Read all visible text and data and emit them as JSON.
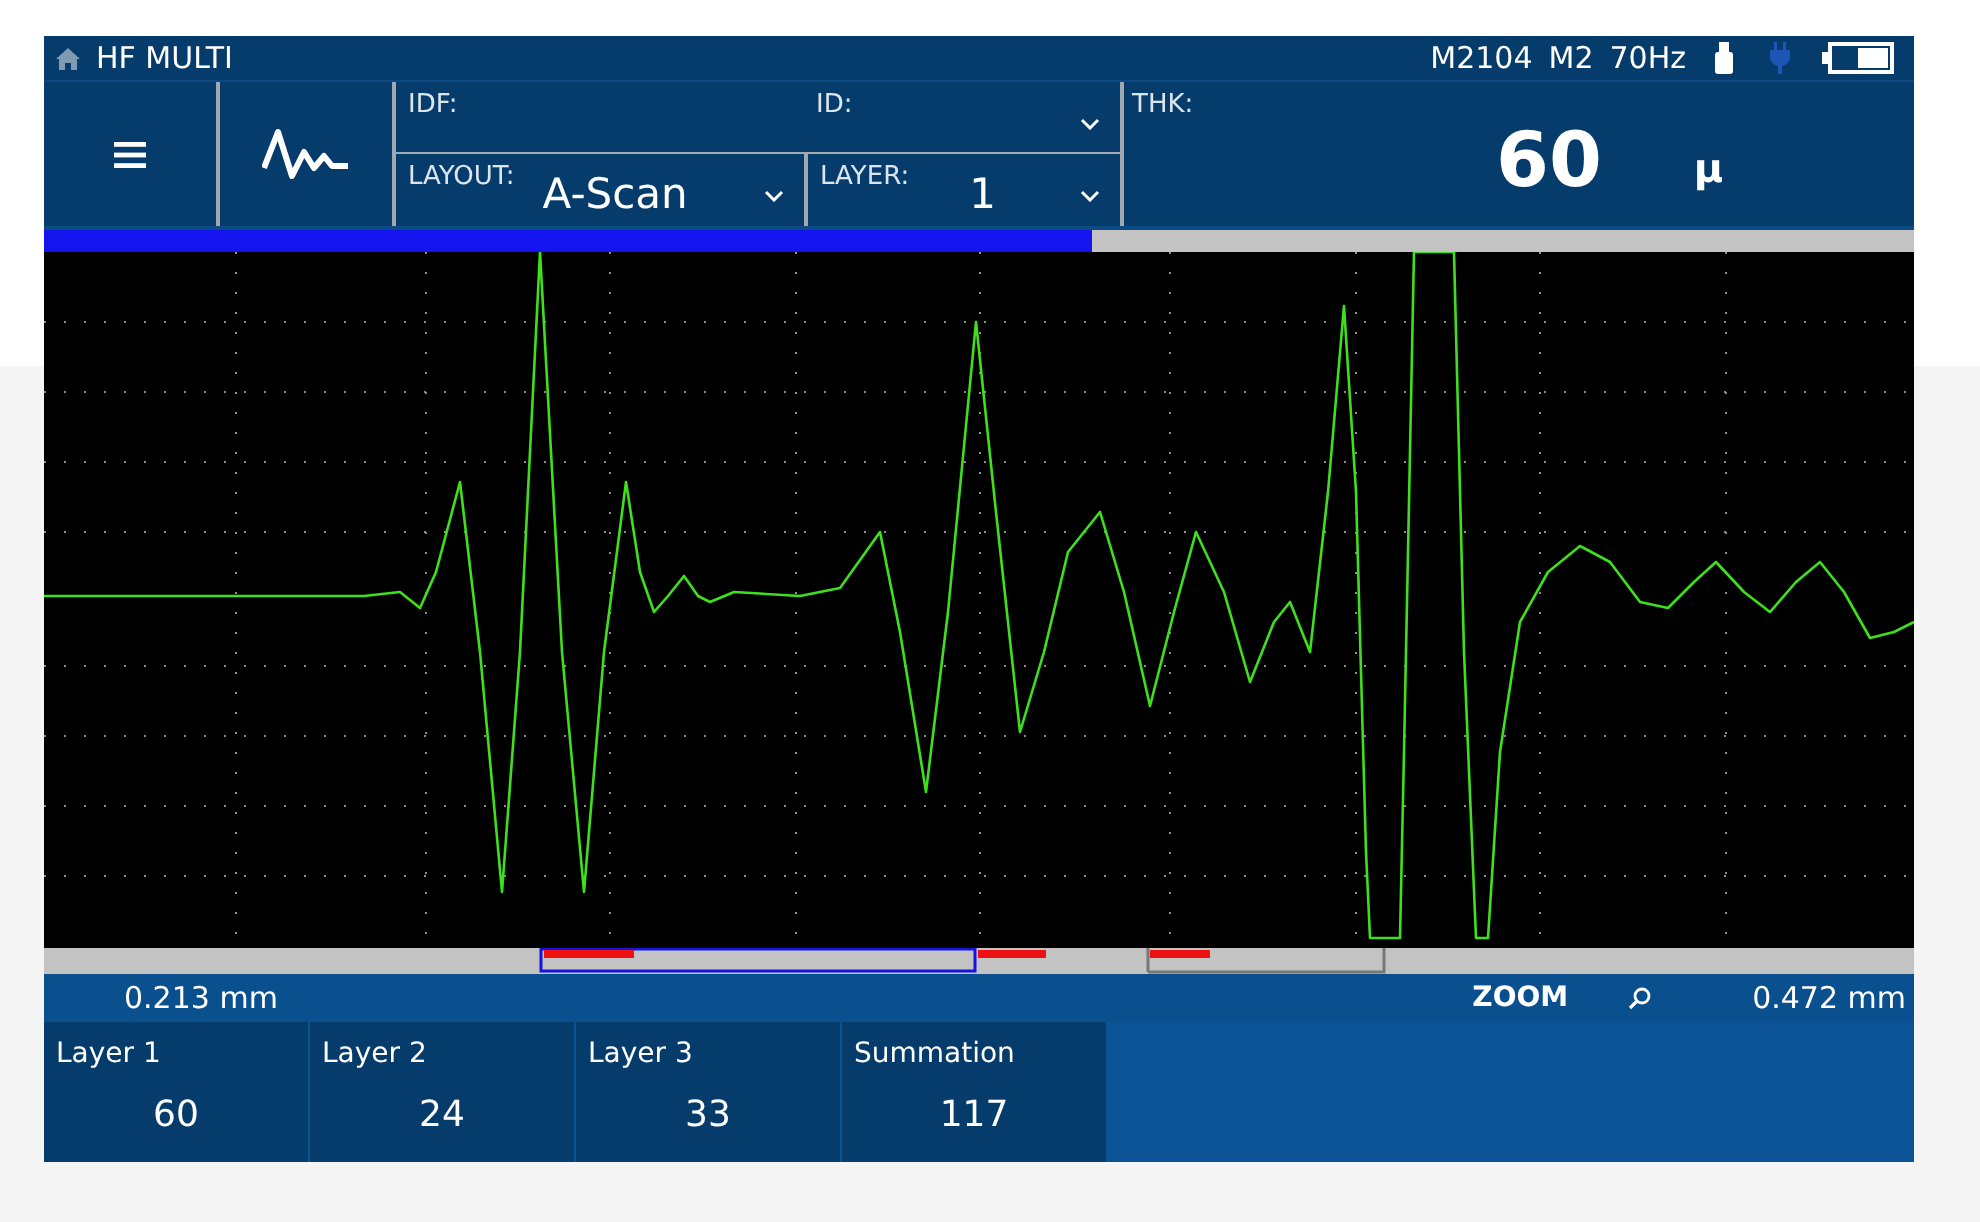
{
  "app": {
    "title": "HF MULTI"
  },
  "status": [
    "M2104",
    "M2",
    "70Hz"
  ],
  "header": {
    "idf_label": "IDF:",
    "id_label": "ID:",
    "layout_label": "LAYOUT:",
    "layout_value": "A-Scan",
    "layer_label": "LAYER:",
    "layer_value": "1",
    "thk_label": "THK:",
    "thk_value": "60",
    "thk_unit": "μ"
  },
  "progress": {
    "level": 0.56
  },
  "range": {
    "start": "0.213 mm",
    "zoom": "ZOOM",
    "end": "0.472 mm"
  },
  "results": [
    {
      "label": "Layer 1",
      "value": "60"
    },
    {
      "label": "Layer 2",
      "value": "24"
    },
    {
      "label": "Layer 3",
      "value": "33"
    },
    {
      "label": "Summation",
      "value": "117"
    }
  ]
}
